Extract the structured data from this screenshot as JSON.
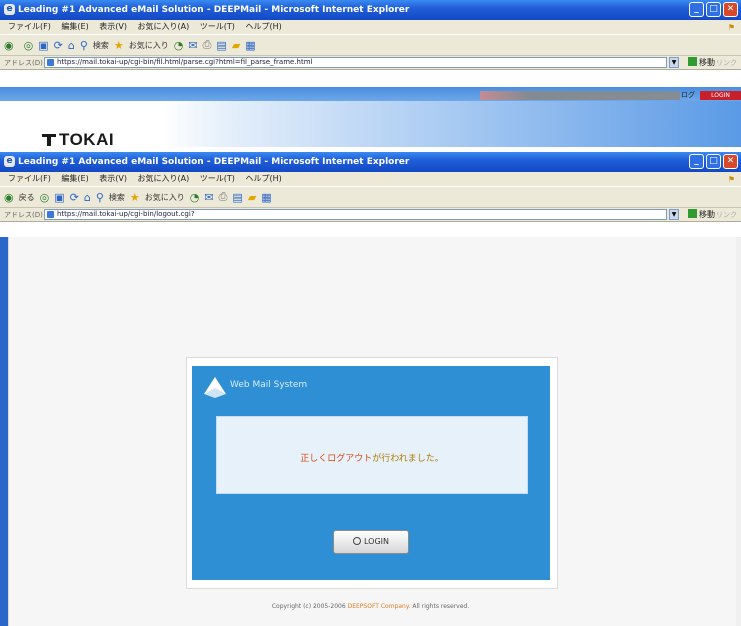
{
  "back_window": {
    "title": "Leading #1 Advanced eMail Solution - DEEPMail - Microsoft Internet Explorer",
    "menu": [
      "ファイル(F)",
      "編集(E)",
      "表示(V)",
      "お気に入り(A)",
      "ツール(T)",
      "ヘルプ(H)"
    ],
    "toolbar": {
      "back": "",
      "search": "検索",
      "favorites": "お気に入り"
    },
    "address_label": "アドレス(D)",
    "address": "https://mail.tokai-up/cgi-bin/fil.html/parse.cgi?html=fil_parse_frame.html",
    "go_label": "移動",
    "links_label": "リンク",
    "portal_tag": "LOGIN",
    "portal_tag_left": "ログ"
  },
  "logo": {
    "text": "TOKAI"
  },
  "front_window": {
    "title": "Leading #1 Advanced eMail Solution - DEEPMail - Microsoft Internet Explorer",
    "menu": [
      "ファイル(F)",
      "編集(E)",
      "表示(V)",
      "お気に入り(A)",
      "ツール(T)",
      "ヘルプ(H)"
    ],
    "toolbar": {
      "back": "戻る",
      "search": "検索",
      "favorites": "お気に入り"
    },
    "address_label": "アドレス(D)",
    "address": "https://mail.tokai-up/cgi-bin/logout.cgi?",
    "go_label": "移動",
    "links_label": "リンク"
  },
  "login_panel": {
    "title": "Web Mail System",
    "message_highlight": "正しくログアウト",
    "message_rest": "が行われました。",
    "login_button": "LOGIN"
  },
  "footer": {
    "copyright_pre": "Copyright (c) 2005-2006",
    "company": "DEEPSOFT Company.",
    "copyright_post": "All rights reserved."
  },
  "colors": {
    "titlebar": "#1f5fd8",
    "panel": "#2f8fd4",
    "message": "#b07a00"
  }
}
